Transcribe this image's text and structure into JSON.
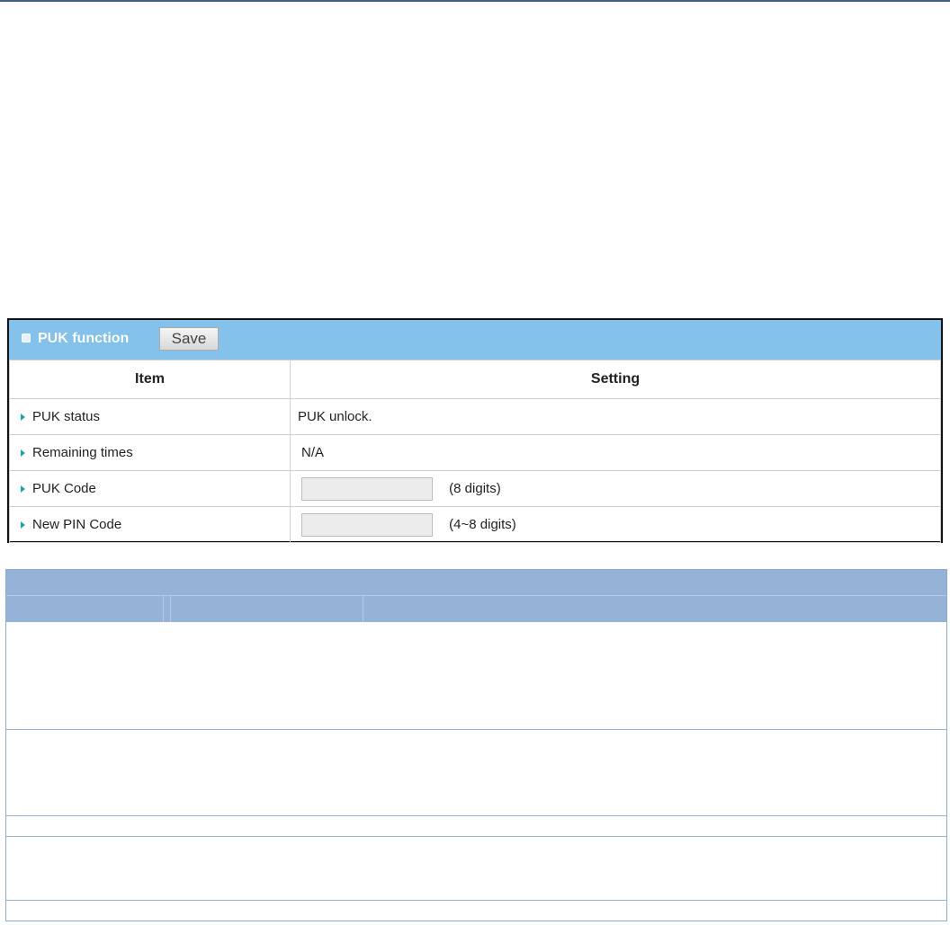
{
  "panel": {
    "title": "PUK function",
    "save_label": "Save",
    "columns": {
      "item": "Item",
      "setting": "Setting"
    },
    "rows": [
      {
        "label": "PUK status",
        "value": "PUK unlock."
      },
      {
        "label": "Remaining times",
        "value": "N/A"
      },
      {
        "label": "PUK Code",
        "input_value": "",
        "hint": "(8 digits)"
      },
      {
        "label": "New PIN Code",
        "input_value": "",
        "hint": "(4~8 digits)"
      }
    ]
  },
  "colors": {
    "panel_header": "#84c2ec",
    "info_header": "#95b3d7",
    "row_arrow": "#18a8a0"
  }
}
